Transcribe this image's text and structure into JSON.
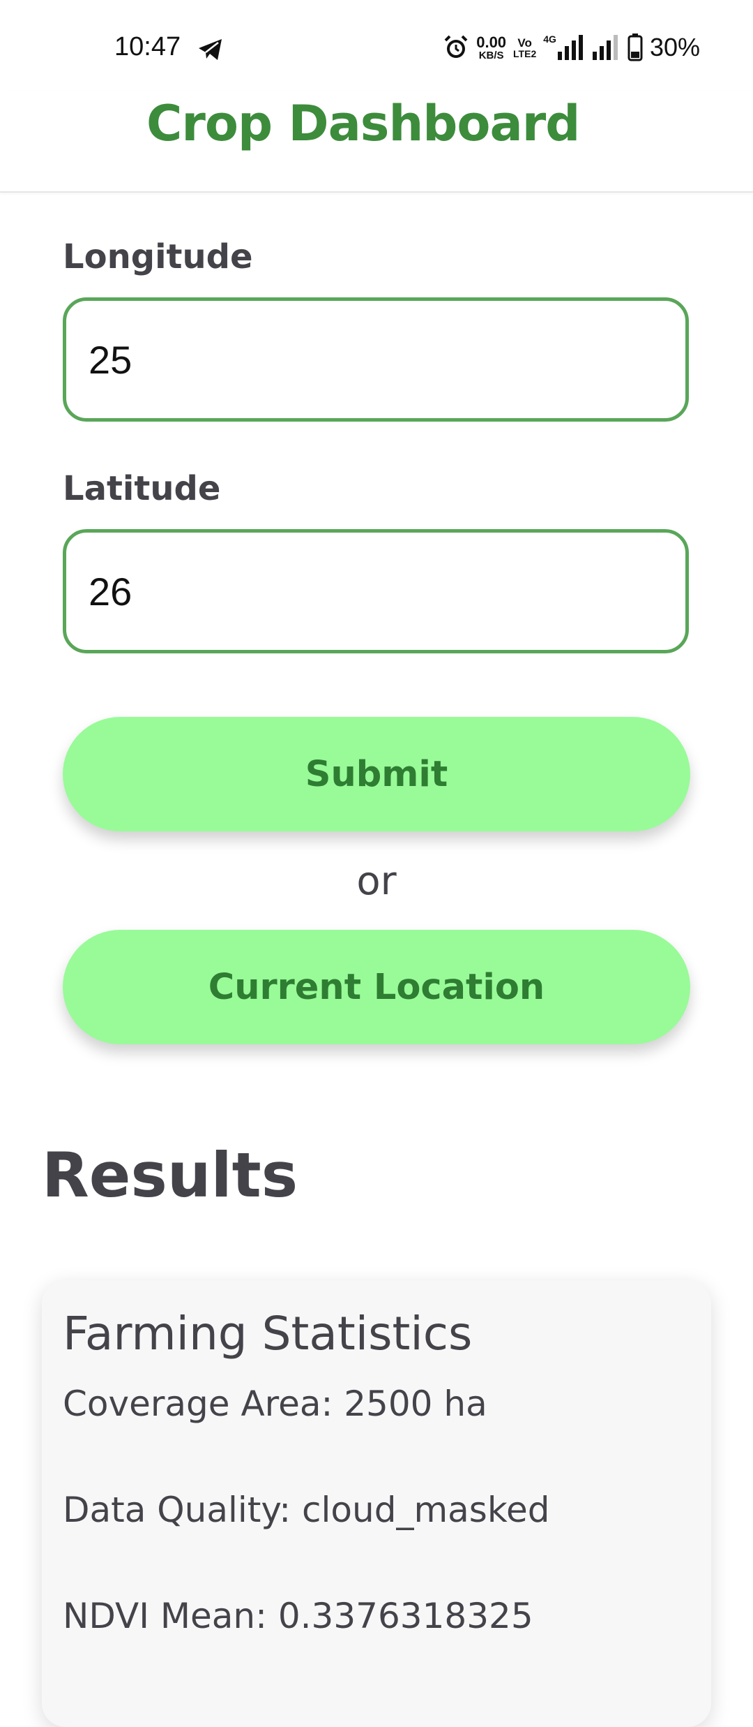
{
  "status_bar": {
    "time": "10:47",
    "net_speed_value": "0.00",
    "net_speed_unit": "KB/S",
    "volte_top": "Vo",
    "volte_bottom": "LTE2",
    "network_type": "4G",
    "battery_percent": "30%",
    "icons": [
      "telegram-icon",
      "alarm-icon",
      "signal-icon",
      "battery-icon"
    ]
  },
  "header": {
    "title": "Crop Dashboard",
    "accent_color": "#3c8c3c"
  },
  "form": {
    "longitude": {
      "label": "Longitude",
      "value": "25"
    },
    "latitude": {
      "label": "Latitude",
      "value": "26"
    },
    "submit_label": "Submit",
    "or_text": "or",
    "current_location_label": "Current Location",
    "button_color": "#98fb98",
    "input_border_color": "#59a659"
  },
  "results": {
    "heading": "Results",
    "card": {
      "title": "Farming Statistics",
      "lines": [
        "Coverage Area: 2500 ha",
        "Data Quality: cloud_masked",
        "NDVI Mean: 0.3376318325"
      ]
    }
  }
}
